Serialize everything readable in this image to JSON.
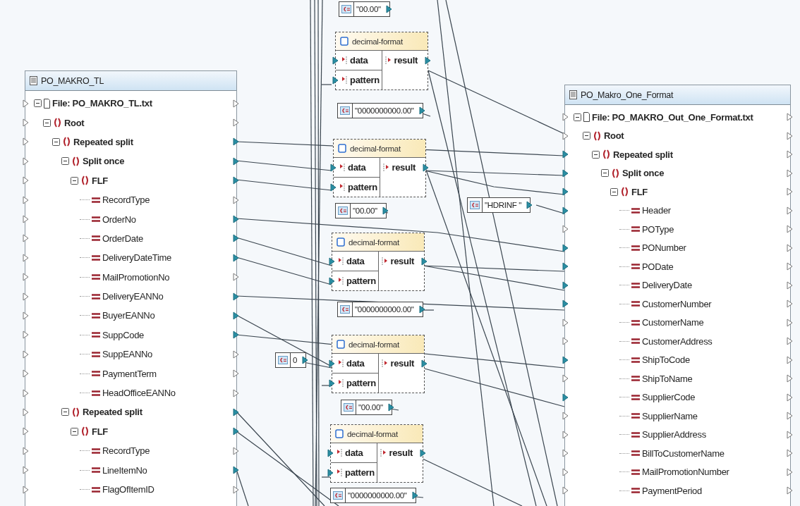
{
  "left_component": {
    "title": "PO_MAKRO_TL",
    "tree": [
      {
        "kind": "file",
        "label": "File: PO_MAKRO_TL.txt",
        "linked_left": false,
        "linked_right": false,
        "expanded": true,
        "children": [
          {
            "kind": "group",
            "label": "Root",
            "linked_left": false,
            "linked_right": false,
            "expanded": true,
            "children": [
              {
                "kind": "group",
                "label": "Repeated split",
                "linked_left": false,
                "linked_right": true,
                "expanded": true,
                "children": [
                  {
                    "kind": "group",
                    "label": "Split once",
                    "linked_left": false,
                    "linked_right": true,
                    "expanded": true,
                    "children": [
                      {
                        "kind": "group",
                        "label": "FLF",
                        "linked_left": false,
                        "linked_right": true,
                        "expanded": true,
                        "children": [
                          {
                            "kind": "field",
                            "label": "RecordType",
                            "linked_left": false,
                            "linked_right": false
                          },
                          {
                            "kind": "field",
                            "label": "OrderNo",
                            "linked_left": false,
                            "linked_right": true
                          },
                          {
                            "kind": "field",
                            "label": "OrderDate",
                            "linked_left": false,
                            "linked_right": true
                          },
                          {
                            "kind": "field",
                            "label": "DeliveryDateTime",
                            "linked_left": false,
                            "linked_right": true
                          },
                          {
                            "kind": "field",
                            "label": "MailPromotionNo",
                            "linked_left": false,
                            "linked_right": false
                          },
                          {
                            "kind": "field",
                            "label": "DeliveryEANNo",
                            "linked_left": false,
                            "linked_right": true
                          },
                          {
                            "kind": "field",
                            "label": "BuyerEANNo",
                            "linked_left": false,
                            "linked_right": true
                          },
                          {
                            "kind": "field",
                            "label": "SuppCode",
                            "linked_left": false,
                            "linked_right": true
                          },
                          {
                            "kind": "field",
                            "label": "SuppEANNo",
                            "linked_left": false,
                            "linked_right": false
                          },
                          {
                            "kind": "field",
                            "label": "PaymentTerm",
                            "linked_left": false,
                            "linked_right": false
                          },
                          {
                            "kind": "field",
                            "label": "HeadOfficeEANNo",
                            "linked_left": false,
                            "linked_right": false
                          }
                        ]
                      }
                    ]
                  },
                  {
                    "kind": "group",
                    "label": "Repeated split",
                    "linked_left": false,
                    "linked_right": true,
                    "expanded": true,
                    "children": [
                      {
                        "kind": "group",
                        "label": "FLF",
                        "linked_left": false,
                        "linked_right": true,
                        "expanded": true,
                        "children": [
                          {
                            "kind": "field",
                            "label": "RecordType",
                            "linked_left": false,
                            "linked_right": false
                          },
                          {
                            "kind": "field",
                            "label": "LineItemNo",
                            "linked_left": false,
                            "linked_right": true
                          },
                          {
                            "kind": "field",
                            "label": "FlagOfItemID",
                            "linked_left": false,
                            "linked_right": false
                          }
                        ]
                      }
                    ]
                  }
                ]
              }
            ]
          }
        ]
      }
    ]
  },
  "functions": [
    {
      "name": "decimal-format",
      "inputs": [
        {
          "label": "data",
          "connected": true
        },
        {
          "label": "pattern",
          "connected": true
        }
      ],
      "output": {
        "label": "result",
        "connected": true
      }
    },
    {
      "name": "decimal-format",
      "inputs": [
        {
          "label": "data",
          "connected": true
        },
        {
          "label": "pattern",
          "connected": true
        }
      ],
      "output": {
        "label": "result",
        "connected": true
      }
    },
    {
      "name": "decimal-format",
      "inputs": [
        {
          "label": "data",
          "connected": true
        },
        {
          "label": "pattern",
          "connected": true
        }
      ],
      "output": {
        "label": "result",
        "connected": true
      }
    },
    {
      "name": "decimal-format",
      "inputs": [
        {
          "label": "data",
          "connected": true
        },
        {
          "label": "pattern",
          "connected": true
        }
      ],
      "output": {
        "label": "result",
        "connected": true
      }
    },
    {
      "name": "decimal-format",
      "inputs": [
        {
          "label": "data",
          "connected": true
        },
        {
          "label": "pattern",
          "connected": true
        }
      ],
      "output": {
        "label": "result",
        "connected": true
      }
    }
  ],
  "constants": [
    {
      "value": "\"00.00\""
    },
    {
      "value": "\"0000000000.00\""
    },
    {
      "value": "\"HDRINF \""
    },
    {
      "value": "\"00.00\""
    },
    {
      "value": "\"0000000000.00\""
    },
    {
      "value": "0"
    },
    {
      "value": "\"00.00\""
    },
    {
      "value": "\"0000000000.00\""
    }
  ],
  "right_component": {
    "title": "PO_Makro_One_Format",
    "tree": [
      {
        "kind": "file",
        "label": "File: PO_MAKRO_Out_One_Format.txt",
        "linked_left": false,
        "linked_right": false,
        "expanded": true,
        "children": [
          {
            "kind": "group",
            "label": "Root",
            "linked_left": false,
            "linked_right": false,
            "expanded": true,
            "children": [
              {
                "kind": "group",
                "label": "Repeated split",
                "linked_left": true,
                "linked_right": false,
                "expanded": true,
                "children": [
                  {
                    "kind": "group",
                    "label": "Split once",
                    "linked_left": true,
                    "linked_right": false,
                    "expanded": true,
                    "children": [
                      {
                        "kind": "group",
                        "label": "FLF",
                        "linked_left": true,
                        "linked_right": false,
                        "expanded": true,
                        "children": [
                          {
                            "kind": "field",
                            "label": "Header",
                            "linked_left": true,
                            "linked_right": false
                          },
                          {
                            "kind": "field",
                            "label": "POType",
                            "linked_left": false,
                            "linked_right": false
                          },
                          {
                            "kind": "field",
                            "label": "PONumber",
                            "linked_left": true,
                            "linked_right": false
                          },
                          {
                            "kind": "field",
                            "label": "PODate",
                            "linked_left": true,
                            "linked_right": false
                          },
                          {
                            "kind": "field",
                            "label": "DeliveryDate",
                            "linked_left": true,
                            "linked_right": false
                          },
                          {
                            "kind": "field",
                            "label": "CustomerNumber",
                            "linked_left": true,
                            "linked_right": false
                          },
                          {
                            "kind": "field",
                            "label": "CustomerName",
                            "linked_left": false,
                            "linked_right": false
                          },
                          {
                            "kind": "field",
                            "label": "CustomerAddress",
                            "linked_left": false,
                            "linked_right": false
                          },
                          {
                            "kind": "field",
                            "label": "ShipToCode",
                            "linked_left": true,
                            "linked_right": false
                          },
                          {
                            "kind": "field",
                            "label": "ShipToName",
                            "linked_left": false,
                            "linked_right": false
                          },
                          {
                            "kind": "field",
                            "label": "SupplierCode",
                            "linked_left": true,
                            "linked_right": false
                          },
                          {
                            "kind": "field",
                            "label": "SupplierName",
                            "linked_left": false,
                            "linked_right": false
                          },
                          {
                            "kind": "field",
                            "label": "SupplierAddress",
                            "linked_left": false,
                            "linked_right": false
                          },
                          {
                            "kind": "field",
                            "label": "BillToCustomerName",
                            "linked_left": false,
                            "linked_right": false
                          },
                          {
                            "kind": "field",
                            "label": "MailPromotionNumber",
                            "linked_left": false,
                            "linked_right": false
                          },
                          {
                            "kind": "field",
                            "label": "PaymentPeriod",
                            "linked_left": false,
                            "linked_right": false
                          }
                        ]
                      }
                    ]
                  }
                ]
              }
            ]
          }
        ]
      }
    ]
  }
}
